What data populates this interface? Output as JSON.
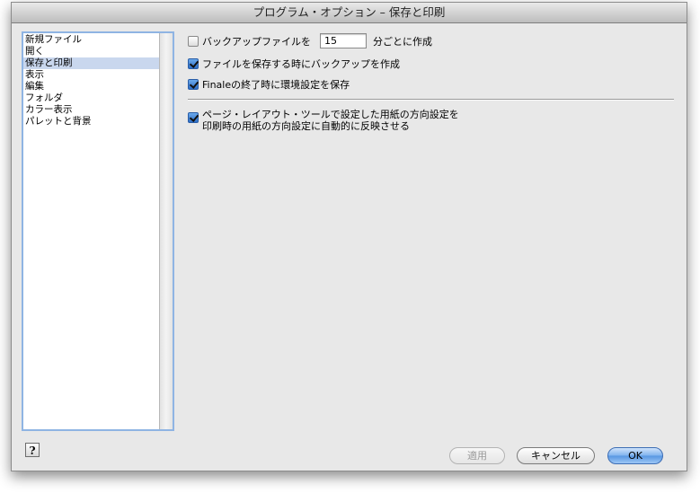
{
  "window": {
    "title": "プログラム・オプション – 保存と印刷"
  },
  "sidebar": {
    "items": [
      {
        "label": "新規ファイル",
        "selected": false
      },
      {
        "label": "開く",
        "selected": false
      },
      {
        "label": "保存と印刷",
        "selected": true
      },
      {
        "label": "表示",
        "selected": false
      },
      {
        "label": "編集",
        "selected": false
      },
      {
        "label": "フォルダ",
        "selected": false
      },
      {
        "label": "カラー表示",
        "selected": false
      },
      {
        "label": "パレットと背景",
        "selected": false
      }
    ]
  },
  "options": {
    "backup_interval": {
      "label_before": "バックアップファイルを",
      "value": "15",
      "label_after": "分ごとに作成",
      "checked": false
    },
    "backup_on_save": {
      "label": "ファイルを保存する時にバックアップを作成",
      "checked": true
    },
    "save_prefs_on_quit": {
      "label": "Finaleの終了時に環境設定を保存",
      "checked": true
    },
    "page_orientation": {
      "line1": "ページ・レイアウト・ツールで設定した用紙の方向設定を",
      "line2": "印刷時の用紙の方向設定に自動的に反映させる",
      "checked": true
    }
  },
  "footer": {
    "help_label": "?",
    "apply_label": "適用",
    "cancel_label": "キャンセル",
    "ok_label": "OK"
  },
  "colors": {
    "accent": "#5796e2",
    "selection": "#c9d7ee",
    "focus_ring": "#8fb4e3"
  }
}
